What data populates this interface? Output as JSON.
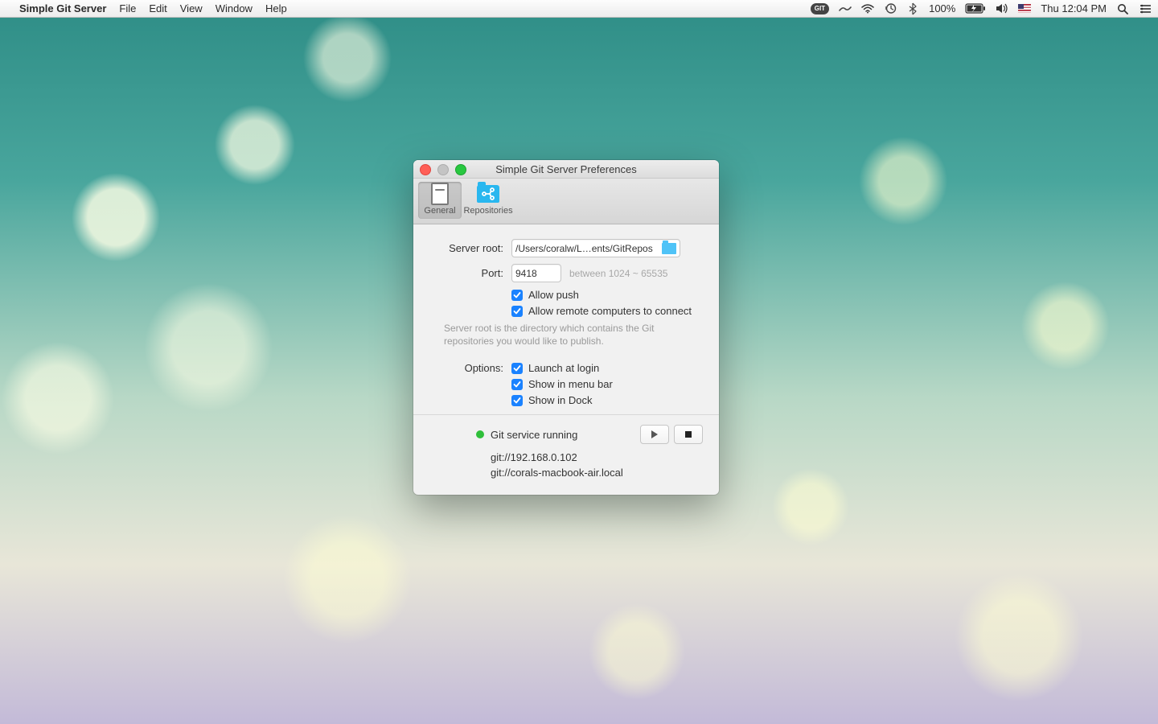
{
  "menubar": {
    "app_name": "Simple Git Server",
    "menus": [
      "File",
      "Edit",
      "View",
      "Window",
      "Help"
    ],
    "git_badge": "GIT",
    "battery_pct": "100%",
    "day_time": "Thu 12:04 PM"
  },
  "window": {
    "title": "Simple Git Server Preferences",
    "tabs": {
      "general": "General",
      "repositories": "Repositories"
    },
    "labels": {
      "server_root": "Server root:",
      "port": "Port:",
      "options": "Options:"
    },
    "server_root_value": "/Users/coralw/L…ents/GitRepos",
    "port_value": "9418",
    "port_hint": "between 1024 ~ 65535",
    "checks": {
      "allow_push": "Allow push",
      "allow_remote": "Allow remote computers to connect",
      "launch_login": "Launch at login",
      "show_menu": "Show in menu bar",
      "show_dock": "Show in Dock"
    },
    "help": "Server root is the directory which contains the Git repositories you would like to publish.",
    "status_text": "Git service running",
    "urls": [
      "git://192.168.0.102",
      "git://corals-macbook-air.local"
    ]
  }
}
